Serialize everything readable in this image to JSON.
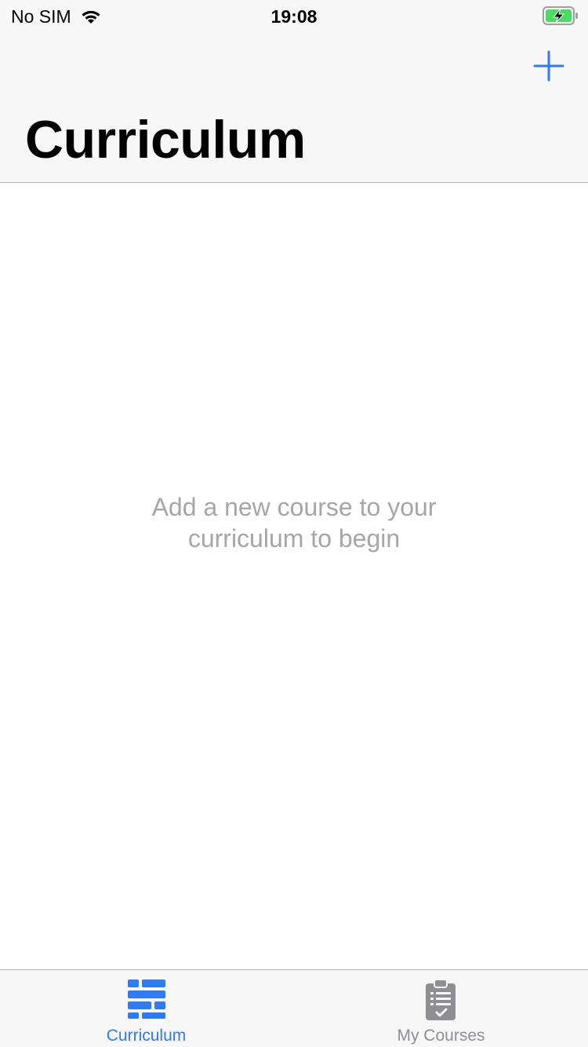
{
  "status_bar": {
    "carrier": "No SIM",
    "time": "19:08",
    "wifi_icon": "wifi-icon",
    "battery_icon": "battery-charging-icon"
  },
  "nav": {
    "title": "Curriculum",
    "add_icon": "plus-icon"
  },
  "empty_state": {
    "line1": "Add a new course to your",
    "line2": "curriculum to begin"
  },
  "tab_bar": {
    "tabs": [
      {
        "label": "Curriculum",
        "icon": "list-blocks-icon",
        "selected": true
      },
      {
        "label": "My Courses",
        "icon": "clipboard-icon",
        "selected": false
      }
    ]
  },
  "colors": {
    "accent": "#2f7af5",
    "inactive": "#8e8e93",
    "placeholder_text": "#a6a6a6",
    "battery_green": "#4cd964"
  }
}
